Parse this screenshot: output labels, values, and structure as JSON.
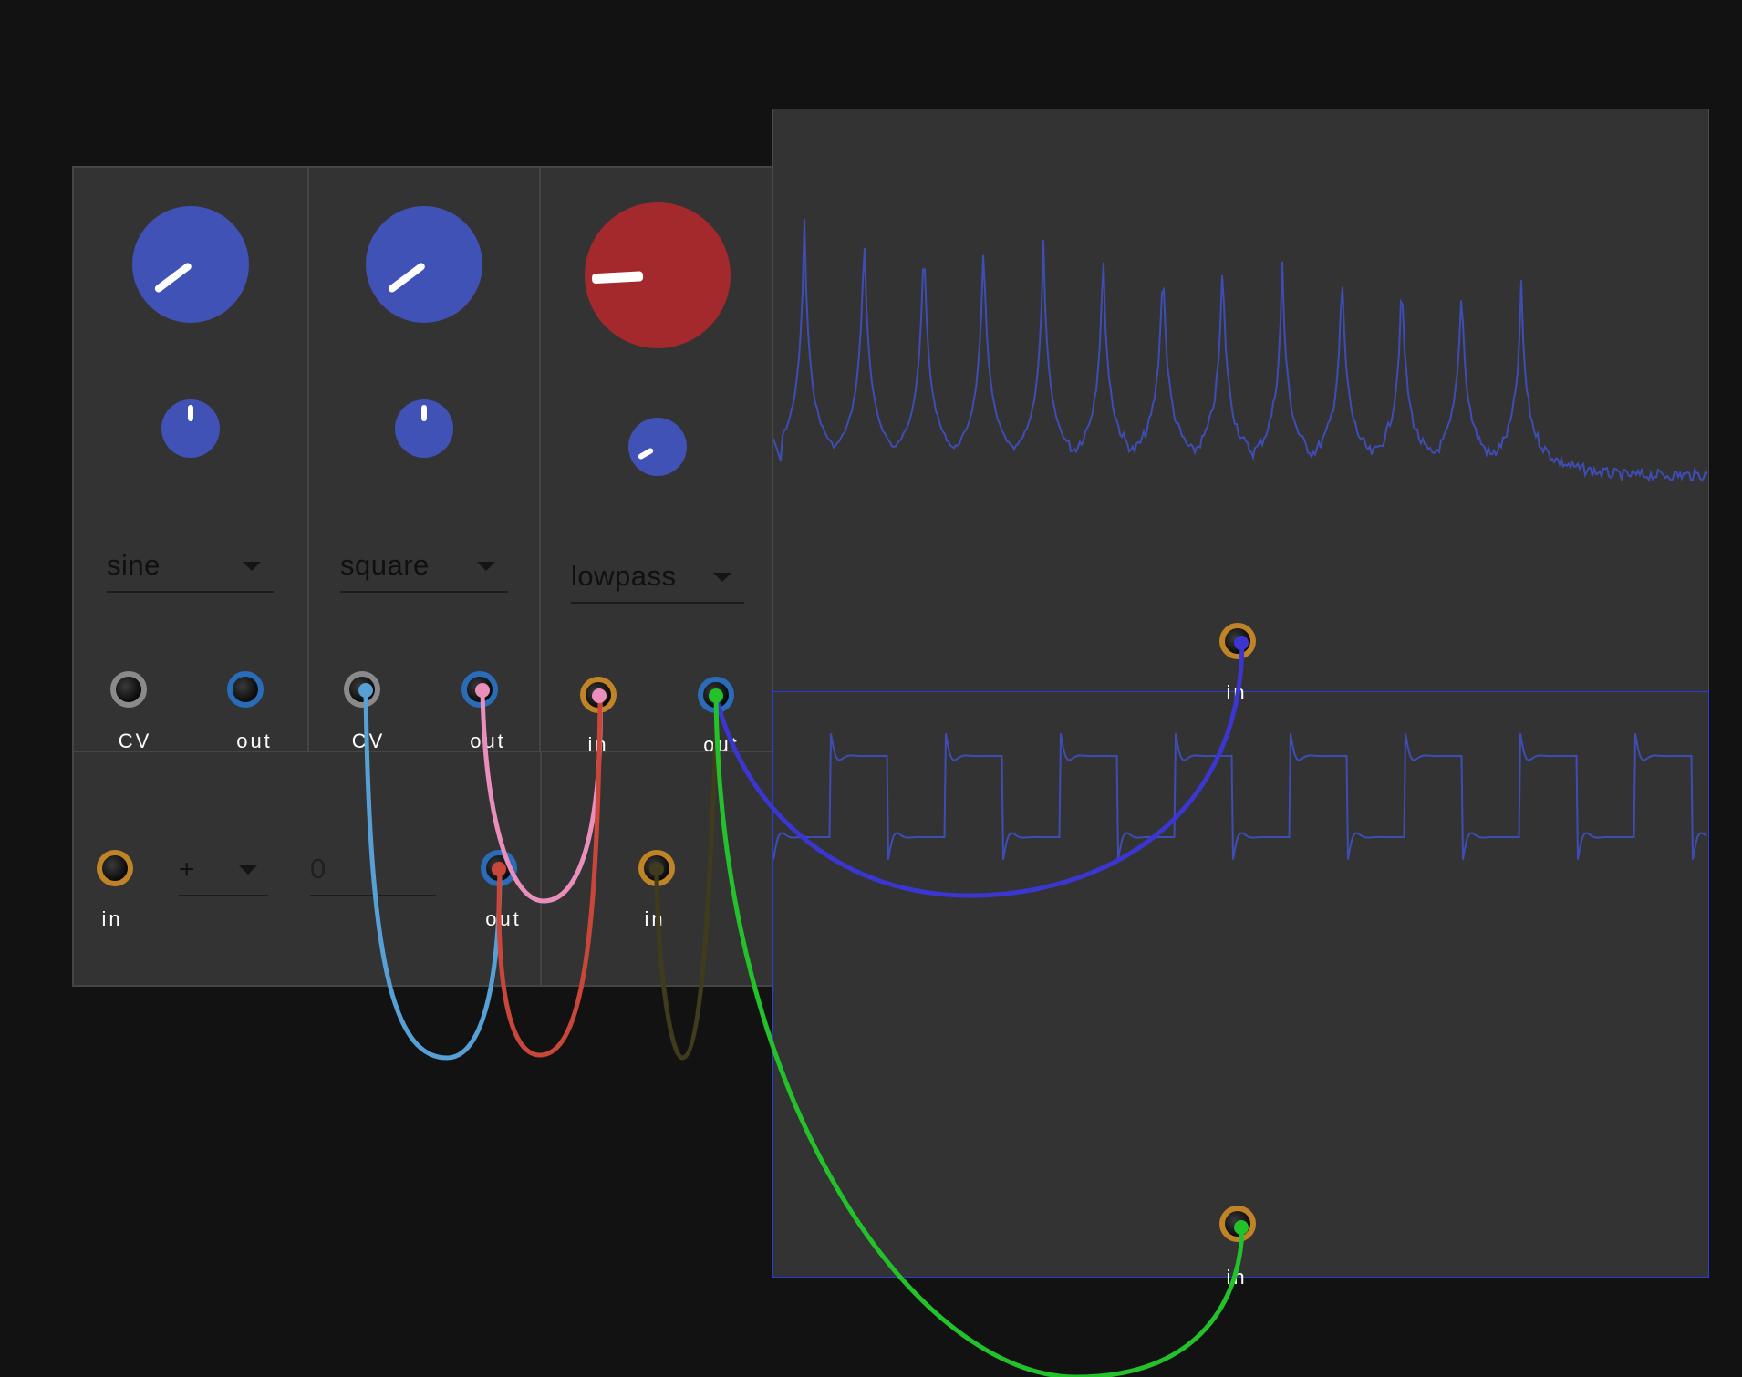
{
  "colors": {
    "background": "#121212",
    "module": "#333333",
    "knob_blue": "#4052b5",
    "knob_red": "#a4292c",
    "jack_input_ring": "#c08326",
    "jack_output_ring": "#2a6cb8",
    "jack_cv_ring": "#8a8a8a",
    "scope_trace": "#3e4db4",
    "scope_selected_border": "#2a3cd8"
  },
  "oscillator_1": {
    "waveform_label": "sine",
    "cv_label": "CV",
    "out_label": "out"
  },
  "oscillator_2": {
    "waveform_label": "square",
    "cv_label": "CV",
    "out_label": "out"
  },
  "filter": {
    "type_label": "lowpass",
    "in_label": "in",
    "out_label": "out"
  },
  "math": {
    "in_label": "in",
    "operator_label": "+",
    "value": "0",
    "out_label": "out"
  },
  "aux": {
    "in_label": "in"
  },
  "spectrum_scope": {
    "in_label": "in"
  },
  "waveform_scope": {
    "in_label": "in"
  },
  "cables": [
    {
      "name": "cable-osc1-cv-to-math-out",
      "color": "#57a0d6"
    },
    {
      "name": "cable-osc2-out-to-math",
      "color": "#ea8fbc"
    },
    {
      "name": "cable-filter-in-to-math-out",
      "color": "#c9473a"
    },
    {
      "name": "cable-aux-to-filter",
      "color": "#3f3b1c"
    },
    {
      "name": "cable-filter-out-to-spectrum",
      "color": "#3a36cf"
    },
    {
      "name": "cable-filter-out-to-waveform",
      "color": "#23c12a"
    }
  ]
}
